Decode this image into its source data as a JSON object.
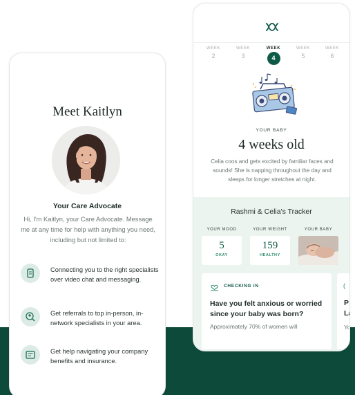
{
  "left_phone": {
    "title": "Meet Kaitlyn",
    "role": "Your Care Advocate",
    "intro": "Hi, I'm Kaitlyn, your Care Advocate. Message me at any time for help with anything you need, including but not limited to:",
    "features": [
      {
        "icon": "video-chat-icon",
        "text": "Connecting you to the right specialists over video chat and messaging."
      },
      {
        "icon": "specialist-search-icon",
        "text": "Get referrals to top in-person, in-network specialists in your area."
      },
      {
        "icon": "benefits-document-icon",
        "text": "Get help navigating your company benefits and insurance."
      }
    ]
  },
  "right_phone": {
    "logo": "app-logo-icon",
    "weeks": [
      {
        "label": "WEEK",
        "num": "2",
        "active": false
      },
      {
        "label": "WEEK",
        "num": "3",
        "active": false
      },
      {
        "label": "WEEK",
        "num": "4",
        "active": true
      },
      {
        "label": "WEEK",
        "num": "5",
        "active": false
      },
      {
        "label": "WEEK",
        "num": "6",
        "active": false
      }
    ],
    "baby_label": "YOUR BABY",
    "age_title": "4 weeks old",
    "description": "Celia coos and gets excited by familiar faces and sounds! She is napping throughout the day and sleeps for longer stretches at night.",
    "tracker": {
      "title": "Rashmi & Celia's Tracker",
      "mood_label": "YOUR MOOD",
      "mood_value": "5",
      "mood_status": "OKAY",
      "weight_label": "YOUR WEIGHT",
      "weight_value": "159",
      "weight_status": "HEALTHY",
      "baby_label": "YOUR BABY"
    },
    "checkin": {
      "label": "CHECKING IN",
      "question": "Have you felt anxious or worried since your baby was born?",
      "subtext": "Approximately 70% of women will"
    },
    "peek_card": {
      "line1": "P",
      "line2": "La",
      "line3": "Yo"
    }
  },
  "colors": {
    "brand_green": "#0e5a47",
    "band_green": "#0e4a3a",
    "accent_green": "#2b8a6f",
    "tracker_bg": "#ecf4f0"
  }
}
